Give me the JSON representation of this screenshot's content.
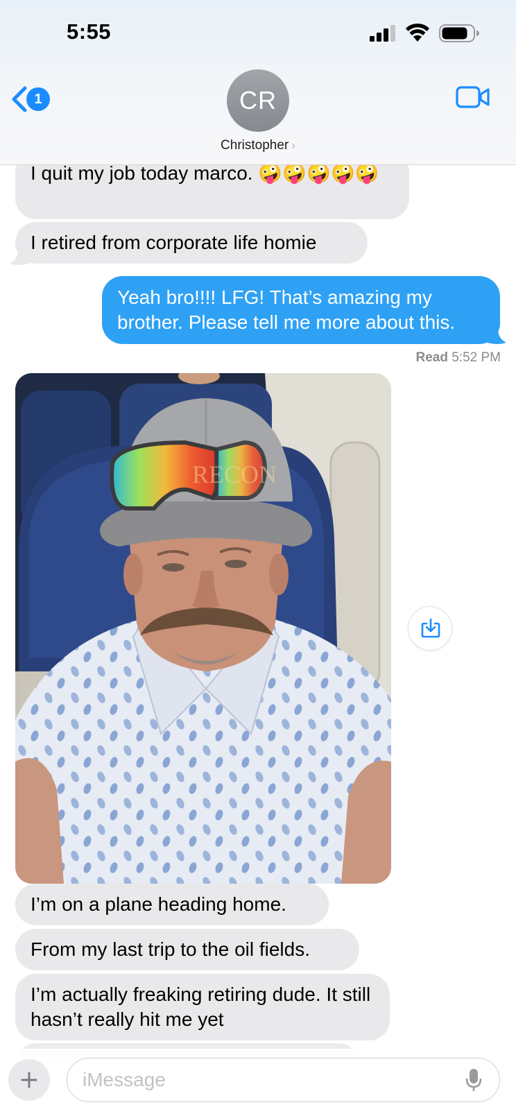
{
  "status_bar": {
    "time": "5:55"
  },
  "header": {
    "back_badge_count": "1",
    "avatar_initials": "CR",
    "contact_name": "Christopher",
    "contact_chevron": "›"
  },
  "messages": [
    {
      "direction": "incoming",
      "text": "I quit my job today marco. 🤪🤪🤪🤪🤪"
    },
    {
      "direction": "incoming",
      "text": "I retired from corporate life homie"
    },
    {
      "direction": "outgoing",
      "text": "Yeah bro!!!! LFG! That’s amazing my brother. Please tell me more about this."
    },
    {
      "direction": "incoming",
      "type": "photo",
      "description_icon": "selfie-photo"
    },
    {
      "direction": "incoming",
      "text": "I’m on a plane heading home."
    },
    {
      "direction": "incoming",
      "text": "From my last trip to the oil fields."
    },
    {
      "direction": "incoming",
      "text": "I’m actually freaking retiring dude. It still hasn’t really hit me yet"
    }
  ],
  "read_receipt": {
    "label": "Read",
    "time": "5:52 PM"
  },
  "photo_cap_text": "RECON",
  "input": {
    "placeholder": "iMessage",
    "value": ""
  },
  "colors": {
    "accent": "#1a8cff",
    "outgoing_bubble": "#2ea1f5",
    "incoming_bubble": "#e9e9eb"
  },
  "icons": {
    "back": "chevron-left-icon",
    "video": "video-camera-icon",
    "save": "save-download-icon",
    "plus": "plus-icon",
    "mic": "microphone-icon"
  }
}
